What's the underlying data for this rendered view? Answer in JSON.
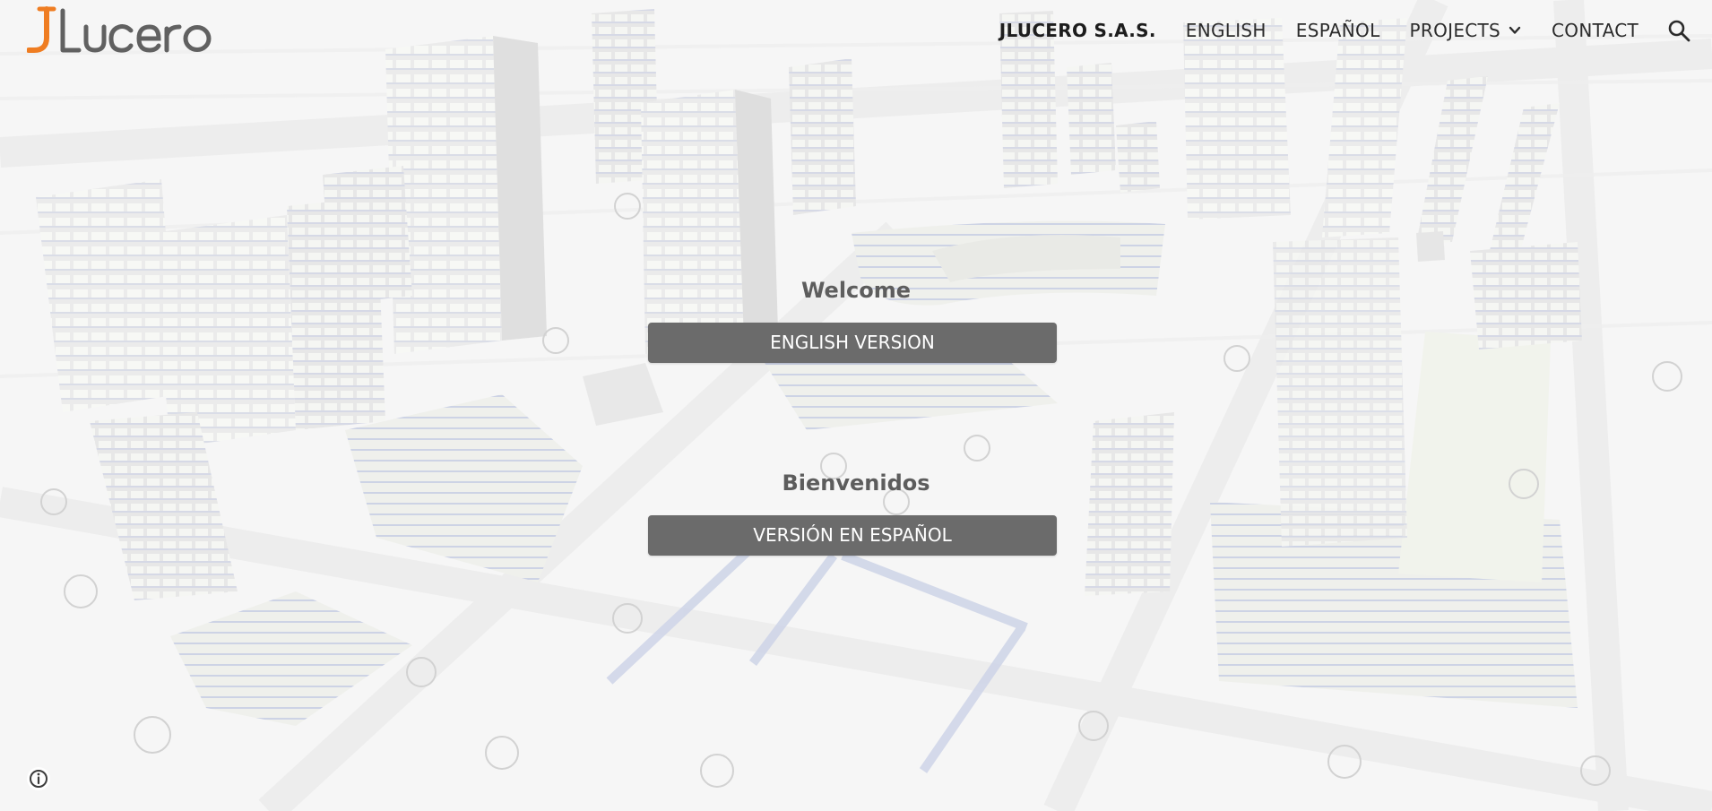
{
  "site": {
    "logo_alt": "JLucero",
    "logo_letter_first": "J",
    "logo_letters_rest": "Lucero"
  },
  "nav": {
    "items": [
      {
        "label": "JLUCERO S.A.S.",
        "active": true
      },
      {
        "label": "ENGLISH",
        "active": false
      },
      {
        "label": "ESPAÑOL",
        "active": false
      },
      {
        "label": "PROJECTS",
        "active": false,
        "has_dropdown": true
      },
      {
        "label": "CONTACT",
        "active": false
      }
    ],
    "search_icon": "search-icon",
    "dropdown_icon": "chevron-down-icon"
  },
  "hero": {
    "english": {
      "heading": "Welcome",
      "button_label": "ENGLISH VERSION"
    },
    "spanish": {
      "heading": "Bienvenidos",
      "button_label": "VERSIÓN EN ESPAÑOL"
    }
  },
  "footer": {
    "info_icon": "info-icon"
  },
  "colors": {
    "logo_accent": "#ef7d22",
    "logo_gray": "#616161",
    "button_bg": "#6b6b6b",
    "heading_text": "#5d5d5d",
    "nav_text": "#2b2b2b"
  }
}
